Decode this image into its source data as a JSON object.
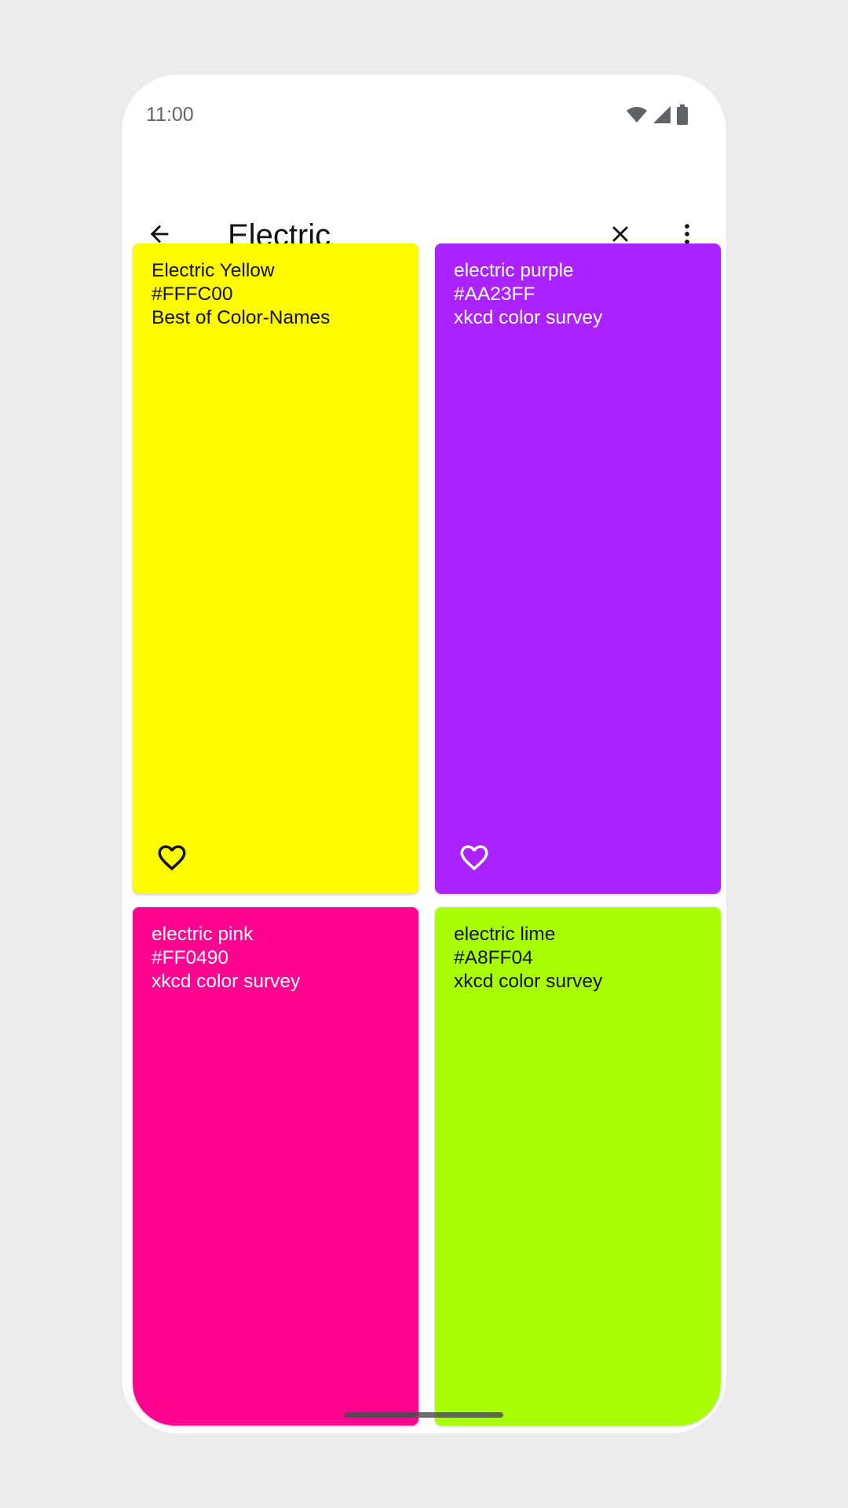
{
  "status_bar": {
    "time": "11:00",
    "icons": [
      "wifi-icon",
      "signal-icon",
      "battery-icon"
    ]
  },
  "toolbar": {
    "back_icon": "arrow-back-icon",
    "search_value": "Electric",
    "clear_icon": "close-icon",
    "more_icon": "more-vert-icon"
  },
  "colors": [
    {
      "name": "Electric Yellow",
      "hex": "#FFFC00",
      "source": "Best of Color-Names",
      "background": "#FFFC00",
      "text_color": "#111111",
      "favorite_icon": "heart-outline-icon"
    },
    {
      "name": "electric purple",
      "hex": "#AA23FF",
      "source": "xkcd color survey",
      "background": "#AA23FF",
      "text_color": "#FFFFFF",
      "favorite_icon": "heart-outline-icon"
    },
    {
      "name": "electric pink",
      "hex": "#FF0490",
      "source": "xkcd color survey",
      "background": "#FF0490",
      "text_color": "#FFFFFF"
    },
    {
      "name": "electric lime",
      "hex": "#A8FF04",
      "source": "xkcd color survey",
      "background": "#A8FF04",
      "text_color": "#111111"
    }
  ]
}
